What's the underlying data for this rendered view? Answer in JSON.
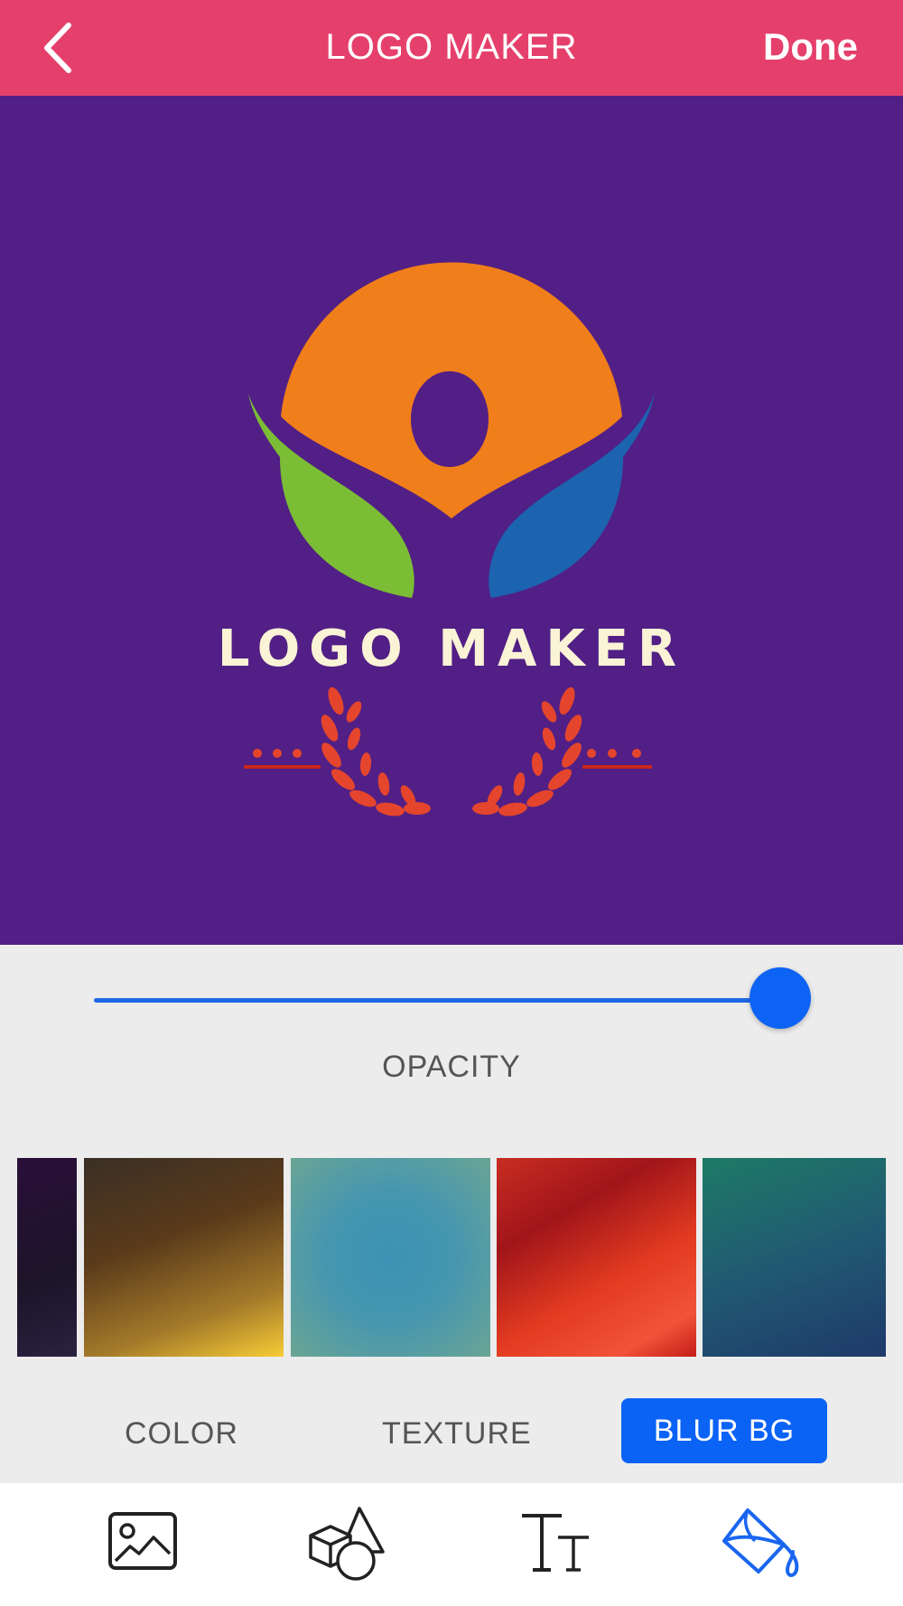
{
  "header": {
    "title": "LOGO MAKER",
    "done_label": "Done",
    "background_color": "#e5406b"
  },
  "canvas": {
    "background_color": "#511f85",
    "brand_text": "LOGO MAKER"
  },
  "opacity": {
    "label": "OPACITY",
    "value": 1.0
  },
  "backgrounds": [
    {
      "name": "dark-purple-blur"
    },
    {
      "name": "brown-yellow-blur"
    },
    {
      "name": "teal-blue-blur"
    },
    {
      "name": "red-orange-blur"
    },
    {
      "name": "green-navy-blur"
    }
  ],
  "tabs": {
    "color": "COLOR",
    "texture": "TEXTURE",
    "blur_bg": "BLUR BG",
    "active": "blur_bg"
  },
  "toolbar": {
    "tools": [
      "image-icon",
      "shapes-icon",
      "text-icon",
      "paint-bucket-icon"
    ],
    "active_tool": "paint-bucket-icon",
    "accent_color": "#0b63f6"
  }
}
